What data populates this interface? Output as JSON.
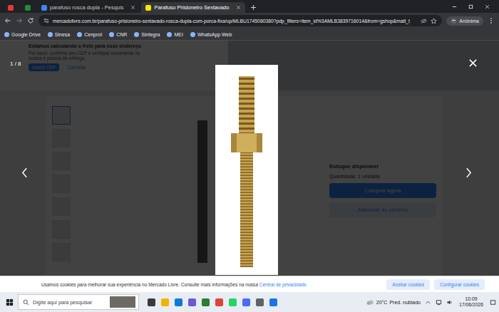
{
  "browser": {
    "pinned_tabs": [
      {
        "color": "#e53935",
        "selected": false
      },
      {
        "color": "#1e8e3e",
        "selected": false
      }
    ],
    "tabs": [
      {
        "label": "parafuso rosca dupla - Pesquis",
        "selected": false,
        "color": "#4285f4"
      },
      {
        "label": "Parafuso Prisioneiro Sextavado",
        "selected": true,
        "color": "#ffe600"
      }
    ],
    "url": "mercadolivre.com.br/parafuso-prisioneiro-sextavado-rosca-dupla-com-porca-fixa/up/MLBU1745080380?pdp_filters=item_id%3AMLB3839716014&from=gshop&matt_t",
    "profile": "Anônima",
    "bookmarks": [
      "Google Drive",
      "Sinesa",
      "Cenprot",
      "CNR",
      "Sintegra",
      "MEI",
      "WhatsApp Web"
    ]
  },
  "page": {
    "shipping": {
      "title": "Estamos calculando o frete para esse endereço",
      "text": "Por favor, confirme seu CEP e verifique novamente os custos e prazos de entrega.",
      "buttons": [
        "Inserir CEP",
        "Cancelar"
      ]
    },
    "thumbnails": [
      {
        "selected": true
      },
      {
        "selected": false
      },
      {
        "selected": false
      },
      {
        "selected": false
      },
      {
        "selected": false
      },
      {
        "selected": false
      },
      {
        "selected": false
      }
    ],
    "stock": "Estoque disponível",
    "quantity": "Quantidade: 1 unidade",
    "buy": "Comprar agora",
    "cart": "Adicionar ao carrinho"
  },
  "lightbox": {
    "counter": "1 / 8"
  },
  "cookies": {
    "text": "Usamos cookies para melhorar sua experiência no Mercado Livre. Consulte mais informações na nossa",
    "link": "Central de privacidade.",
    "buttons": [
      "Aceitar cookies",
      "Configurar cookies"
    ]
  },
  "taskbar": {
    "search": "Digite aqui para pesquisar",
    "temperature": "20°C",
    "weather": "Pred. nublado",
    "time": "10:09",
    "date": "17/06/2026"
  }
}
